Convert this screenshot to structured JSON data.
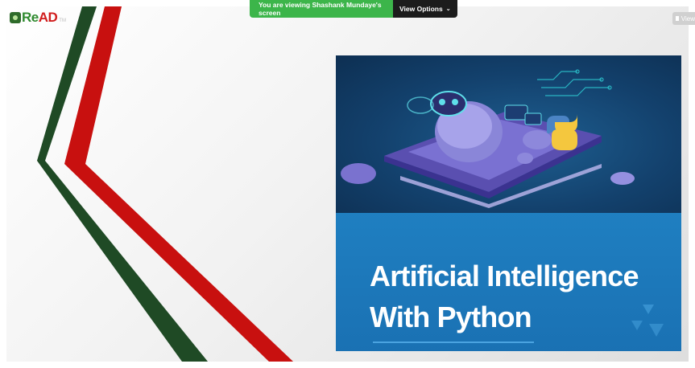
{
  "meeting": {
    "share_status": "You are viewing Shashank Mundaye's screen",
    "view_options_label": "View Options",
    "view_button_label": "View"
  },
  "logo": {
    "text_part1": "Re",
    "text_part2": "AD",
    "subtext": "TM"
  },
  "slide": {
    "title_line1": "Artificial Intelligence",
    "title_line2": "With Python",
    "colors": {
      "ribbon_green": "#1f4a25",
      "ribbon_red": "#c8100f",
      "banner_blue": "#1f7fc1",
      "header_dark_blue": "#13416d"
    }
  },
  "icons": [
    "chevron-down-icon",
    "gallery-view-icon",
    "robot-illustration",
    "python-logo-icon"
  ]
}
